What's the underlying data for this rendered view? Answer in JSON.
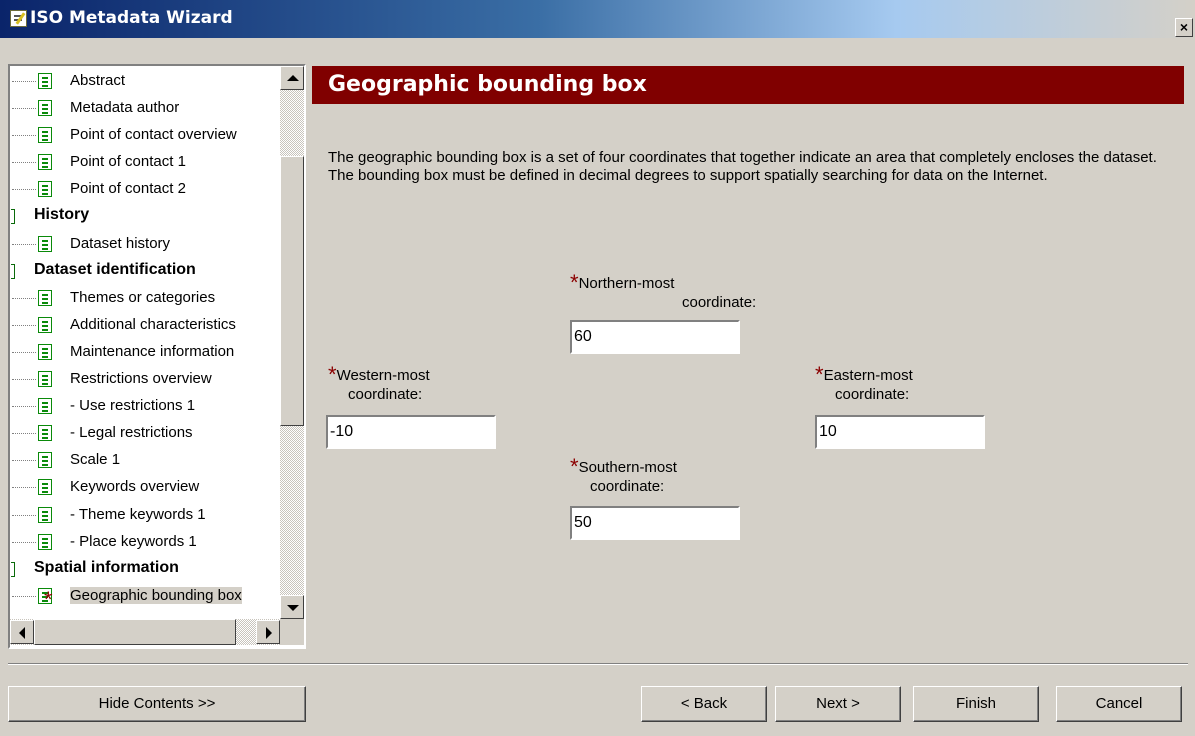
{
  "window": {
    "title": "ISO Metadata Wizard",
    "close_glyph": "×"
  },
  "tree": {
    "items": [
      {
        "type": "page",
        "label": "Abstract"
      },
      {
        "type": "page",
        "label": "Metadata author"
      },
      {
        "type": "page",
        "label": "Point of contact overview"
      },
      {
        "type": "page",
        "label": "Point of contact 1"
      },
      {
        "type": "page",
        "label": "Point of contact 2"
      },
      {
        "type": "section",
        "label": "History"
      },
      {
        "type": "page",
        "label": "Dataset history"
      },
      {
        "type": "section",
        "label": "Dataset identification"
      },
      {
        "type": "page",
        "label": "Themes or categories"
      },
      {
        "type": "page",
        "label": "Additional characteristics"
      },
      {
        "type": "page",
        "label": "Maintenance information"
      },
      {
        "type": "page",
        "label": "Restrictions overview"
      },
      {
        "type": "page",
        "label": "- Use restrictions 1"
      },
      {
        "type": "page",
        "label": "- Legal restrictions"
      },
      {
        "type": "page",
        "label": "Scale 1"
      },
      {
        "type": "page",
        "label": "Keywords overview"
      },
      {
        "type": "page",
        "label": "- Theme keywords 1"
      },
      {
        "type": "page",
        "label": "- Place keywords 1"
      },
      {
        "type": "section",
        "label": "Spatial information"
      },
      {
        "type": "page",
        "label": "Geographic bounding box",
        "selected": true,
        "required": true
      }
    ]
  },
  "page": {
    "title": "Geographic bounding box",
    "description": "The geographic bounding box is a set of four coordinates that together indicate an area that completely encloses the dataset. The bounding box must be defined in decimal degrees to support spatially searching for data on the Internet."
  },
  "fields": {
    "required_marker": "*",
    "north": {
      "label_line1": "Northern-most",
      "label_line2": "coordinate:",
      "value": "60"
    },
    "west": {
      "label_line1": "Western-most",
      "label_line2": "coordinate:",
      "value": "-10"
    },
    "east": {
      "label_line1": "Eastern-most",
      "label_line2": "coordinate:",
      "value": "10"
    },
    "south": {
      "label_line1": "Southern-most",
      "label_line2": "coordinate:",
      "value": "50"
    }
  },
  "buttons": {
    "hide_contents": "Hide Contents >>",
    "back": "< Back",
    "next": "Next >",
    "finish": "Finish",
    "cancel": "Cancel"
  },
  "colors": {
    "header_bg": "#800000",
    "required_star": "#8b0000",
    "title_bar": "#0a246a"
  }
}
